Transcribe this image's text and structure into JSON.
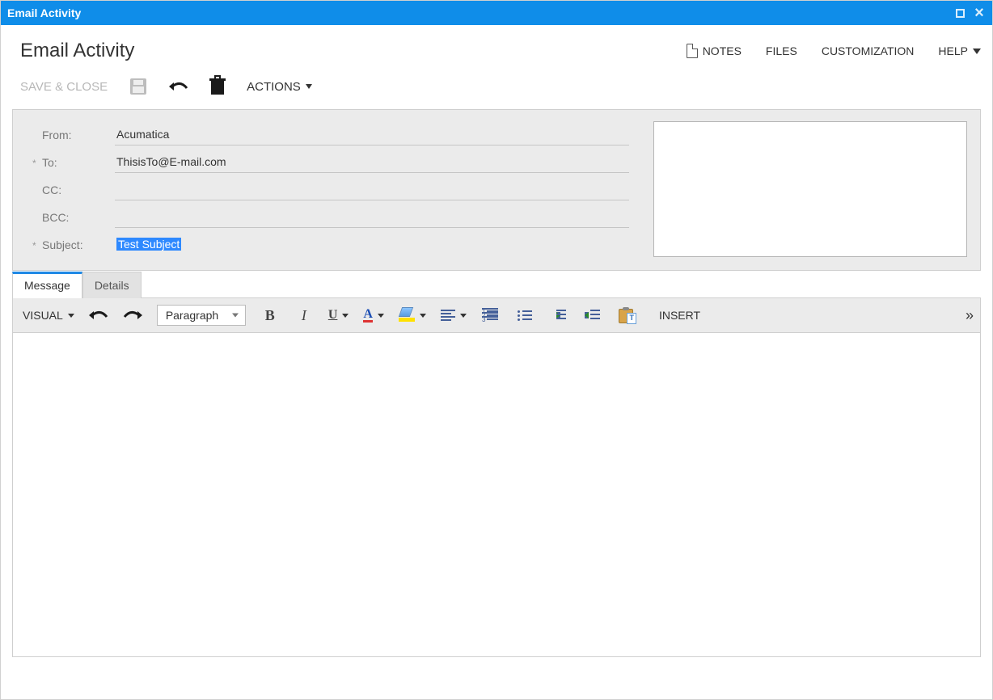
{
  "window": {
    "title": "Email Activity"
  },
  "page": {
    "title": "Email Activity"
  },
  "headerActions": {
    "notes": "NOTES",
    "files": "FILES",
    "customization": "CUSTOMIZATION",
    "help": "HELP"
  },
  "toolbar": {
    "saveClose": "SAVE & CLOSE",
    "actions": "ACTIONS"
  },
  "form": {
    "labels": {
      "from": "From:",
      "to": "To:",
      "cc": "CC:",
      "bcc": "BCC:",
      "subject": "Subject:"
    },
    "values": {
      "from": "Acumatica",
      "to": "ThisisTo@E-mail.com",
      "cc": "",
      "bcc": "",
      "subject": "Test Subject"
    }
  },
  "tabs": {
    "message": "Message",
    "details": "Details"
  },
  "editor": {
    "visual": "VISUAL",
    "paragraph": "Paragraph",
    "insert": "INSERT",
    "underline_glyph": "U",
    "bold_glyph": "B",
    "italic_glyph": "I",
    "color_glyph": "A",
    "overflow": "»"
  }
}
